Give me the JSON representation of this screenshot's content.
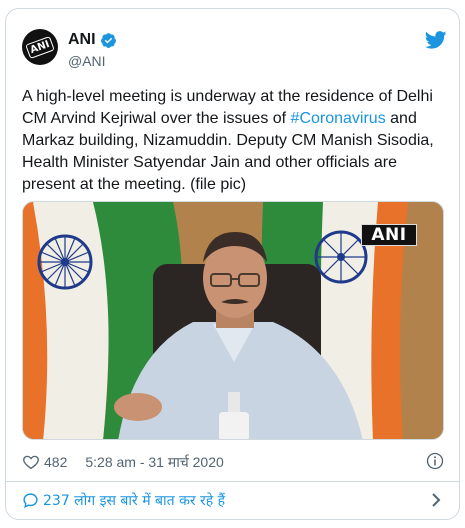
{
  "colors": {
    "accent": "#1b95e0",
    "text": "#14171a",
    "muted": "#536471",
    "border": "#cfd9de"
  },
  "author": {
    "display_name": "ANI",
    "handle": "@ANI",
    "verified": true,
    "avatar_text": "ANI"
  },
  "tweet": {
    "text_before": "A high-level meeting is underway at the residence of Delhi CM Arvind Kejriwal over the issues of ",
    "hashtag": "#Coronavirus",
    "text_after": " and Markaz building, Nizamuddin. Deputy CM Manish Sisodia, Health Minister Satyendar Jain and other officials are present at the meeting. (file pic)"
  },
  "media": {
    "watermark": "ANI"
  },
  "meta": {
    "likes": "482",
    "timestamp": "5:28 am - 31 मार्च 2020"
  },
  "footer": {
    "replies_text": "237 लोग इस बारे में बात कर रहे हैं"
  },
  "icons": {
    "verified": "verified-badge-icon",
    "platform": "twitter-bird-icon",
    "like": "heart-icon",
    "info": "info-icon",
    "reply": "speech-bubble-icon",
    "chevron": "chevron-right-icon"
  }
}
